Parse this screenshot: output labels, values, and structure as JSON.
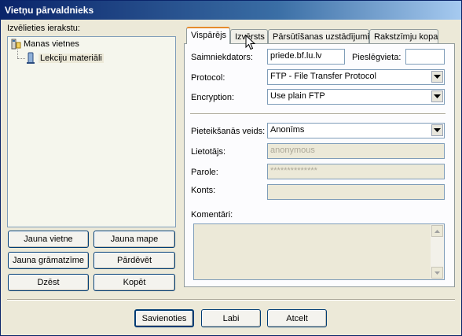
{
  "window": {
    "title": "Vietņu pārvaldnieks"
  },
  "left": {
    "label": "Izvēlieties ierakstu:",
    "tree": [
      {
        "label": "Manas vietnes",
        "icon": "computer-folder-icon"
      },
      {
        "label": "Lekciju materiāli",
        "icon": "server-icon"
      }
    ],
    "buttons": {
      "new_site": "Jauna vietne",
      "new_folder": "Jauna mape",
      "new_bookmark": "Jauna grāmatzīme",
      "rename": "Pārdēvēt",
      "delete": "Dzēst",
      "copy": "Kopēt"
    }
  },
  "tabs": [
    "Vispārējs",
    "Izvērsts",
    "Pārsūtīšanas uzstādījumi",
    "Rakstzīmju kopa"
  ],
  "general": {
    "host_label": "Saimniekdators:",
    "host_value": "priede.bf.lu.lv",
    "port_label": "Pieslēgvieta:",
    "port_value": "",
    "protocol_label": "Protocol:",
    "protocol_value": "FTP - File Transfer Protocol",
    "encryption_label": "Encryption:",
    "encryption_value": "Use plain FTP",
    "logon_label": "Pieteikšanās veids:",
    "logon_value": "Anonīms",
    "user_label": "Lietotājs:",
    "user_value": "anonymous",
    "password_label": "Parole:",
    "password_value": "**************",
    "account_label": "Konts:",
    "account_value": "",
    "comments_label": "Komentāri:"
  },
  "footer": {
    "connect": "Savienoties",
    "ok": "Labi",
    "cancel": "Atcelt"
  },
  "colors": {
    "title_gradient_start": "#0a246a",
    "dialog_bg": "#ece9d8",
    "active_tab_accent": "#e68b2c"
  }
}
